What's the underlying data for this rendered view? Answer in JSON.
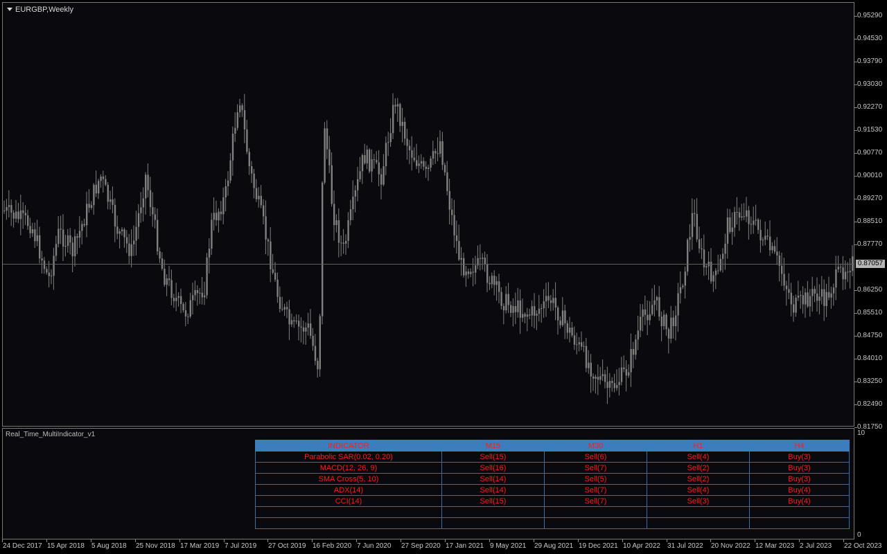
{
  "chart": {
    "title": "EURGBP,Weekly",
    "current_price": "0.87057",
    "price_labels": [
      "0.95290",
      "0.94530",
      "0.93790",
      "0.93030",
      "0.92270",
      "0.91530",
      "0.90770",
      "0.90010",
      "0.89270",
      "0.88510",
      "0.87770",
      "0.86250",
      "0.85510",
      "0.84750",
      "0.84010",
      "0.83250",
      "0.82490",
      "0.81750"
    ],
    "time_labels": [
      "24 Dec 2017",
      "15 Apr 2018",
      "5 Aug 2018",
      "25 Nov 2018",
      "17 Mar 2019",
      "7 Jul 2019",
      "27 Oct 2019",
      "16 Feb 2020",
      "7 Jun 2020",
      "27 Sep 2020",
      "17 Jan 2021",
      "9 May 2021",
      "29 Aug 2021",
      "19 Dec 2021",
      "10 Apr 2022",
      "31 Jul 2022",
      "20 Nov 2022",
      "12 Mar 2023",
      "2 Jul 2023",
      "22 Oct 2023"
    ],
    "candle_color": "#808080"
  },
  "indicator_window": {
    "title": "Real_Time_MultiIndicator_v1",
    "scale_top": "10",
    "scale_bottom": "0"
  },
  "table": {
    "headers": [
      "INDICATOR",
      "M15",
      "M30",
      "H1",
      "H4"
    ],
    "rows": [
      [
        "Parabolic SAR(0.02, 0.20)",
        "Sell(15)",
        "Sell(6)",
        "Sell(4)",
        "Buy(3)"
      ],
      [
        "MACD(12, 26, 9)",
        "Sell(16)",
        "Sell(7)",
        "Sell(2)",
        "Buy(3)"
      ],
      [
        "SMA Cross(5, 10)",
        "Sell(14)",
        "Sell(5)",
        "Sell(2)",
        "Buy(3)"
      ],
      [
        "ADX(14)",
        "Sell(14)",
        "Sell(7)",
        "Sell(4)",
        "Buy(4)"
      ],
      [
        "CCI(14)",
        "Sell(15)",
        "Sell(7)",
        "Sell(3)",
        "Buy(4)"
      ],
      [
        "",
        "",
        "",
        "",
        ""
      ],
      [
        "",
        "",
        "",
        "",
        ""
      ]
    ],
    "header_bg": "#3c7dbd",
    "text_color": "#ff1a1a"
  }
}
